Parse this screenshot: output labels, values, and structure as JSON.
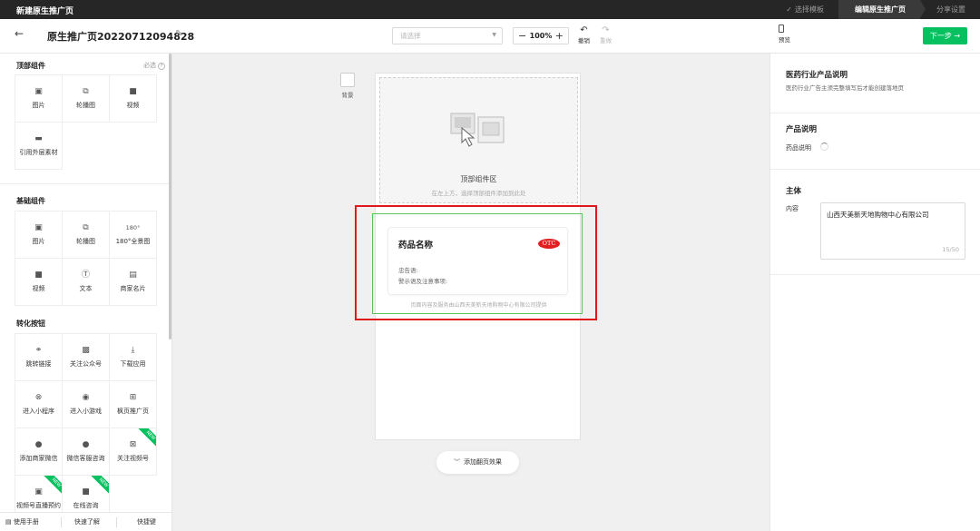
{
  "topbar": {
    "title": "新建原生推广页",
    "steps": [
      {
        "label": "选择模板",
        "state": "done"
      },
      {
        "label": "编辑原生推广页",
        "state": "active"
      },
      {
        "label": "分享设置",
        "state": "pending"
      }
    ]
  },
  "toolbar": {
    "page_title": "原生推广页20220712094828",
    "select_placeholder": "请选择",
    "zoom": "100%",
    "undo_label": "撤销",
    "redo_label": "重做",
    "preview_label": "预览",
    "next_label": "下一步 →"
  },
  "left_panel": {
    "top_components": {
      "title": "顶部组件",
      "required_label": "必选",
      "items": [
        {
          "label": "图片",
          "icon": "image-icon"
        },
        {
          "label": "轮播图",
          "icon": "carousel-icon"
        },
        {
          "label": "视频",
          "icon": "video-icon"
        },
        {
          "label": "引用外层素材",
          "icon": "external-material-icon"
        }
      ]
    },
    "basic_components": {
      "title": "基础组件",
      "items": [
        {
          "label": "图片",
          "icon": "image-icon"
        },
        {
          "label": "轮播图",
          "icon": "carousel-icon"
        },
        {
          "label": "180°全景图",
          "icon": "panorama-icon",
          "icon_text": "180°"
        },
        {
          "label": "视频",
          "icon": "video-icon"
        },
        {
          "label": "文本",
          "icon": "text-icon"
        },
        {
          "label": "商家名片",
          "icon": "business-card-icon"
        }
      ]
    },
    "conversion_buttons": {
      "title": "转化按钮",
      "items": [
        {
          "label": "跳转链接",
          "icon": "link-icon"
        },
        {
          "label": "关注公众号",
          "icon": "official-account-icon"
        },
        {
          "label": "下载应用",
          "icon": "download-icon"
        },
        {
          "label": "进入小程序",
          "icon": "mini-program-icon"
        },
        {
          "label": "进入小游戏",
          "icon": "mini-game-icon"
        },
        {
          "label": "枫页推广页",
          "icon": "promo-page-icon"
        },
        {
          "label": "添加商家微信",
          "icon": "wechat-add-icon"
        },
        {
          "label": "微信客服咨询",
          "icon": "customer-service-icon"
        },
        {
          "label": "关注视频号",
          "icon": "channels-icon",
          "badge": "NEW"
        },
        {
          "label": "视频号直播预约",
          "icon": "live-reserve-icon",
          "badge": "NEW"
        },
        {
          "label": "在线咨询",
          "icon": "online-consult-icon",
          "badge": "NEW"
        }
      ]
    },
    "footer": {
      "manual": "使用手册",
      "quick_start": "快速了解",
      "shortcuts": "快捷键"
    }
  },
  "canvas": {
    "background_label": "背景",
    "top_zone_title": "顶部组件区",
    "top_zone_hint": "在左上方，选择顶部组件添加到此处",
    "drug_name": "药品名称",
    "otc_badge": "OTC",
    "warning_label": "忠告语:",
    "notice_label": "警示语及注意事项:",
    "provider_note": "页面内容及服务由山西天美新天地购物中心有限公司提供",
    "flip_effect": "添加翻页效果",
    "highlight_color": "#e0181c",
    "selection_color": "#5cc45c"
  },
  "right_panel": {
    "header_title": "医药行业产品说明",
    "header_sub": "医药行业广告主须完整填写后才能创建落地页",
    "product_desc_title": "产品说明",
    "product_desc_label": "药品说明",
    "subject_title": "主体",
    "content_label": "内容",
    "content_value": "山西天美新天地购物中心有限公司",
    "content_count": "15/50"
  },
  "colors": {
    "brand_green": "#07c160",
    "topbar_bg": "#262626"
  }
}
